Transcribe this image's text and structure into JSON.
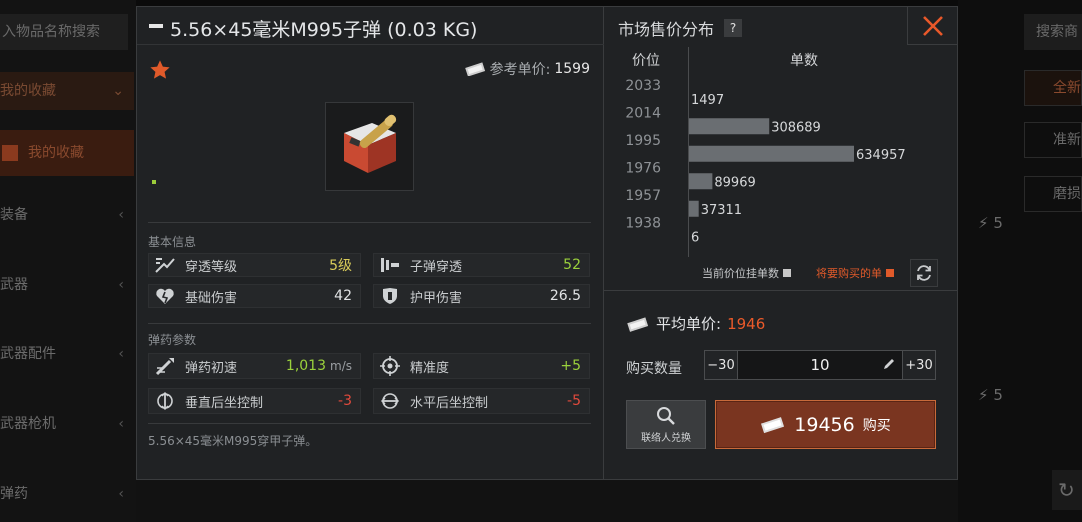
{
  "background": {
    "search_text": "入物品名称搜索",
    "fav_label": "我的收藏",
    "my_fav_label": "我的收藏",
    "categories": [
      "装备",
      "武器",
      "武器配件",
      "武器枪机",
      "弹药"
    ],
    "right_search": "搜索商",
    "right_buttons": [
      "全新",
      "准新",
      "磨损"
    ],
    "right_nums": [
      "5",
      "5"
    ]
  },
  "dialog": {
    "title": "5.56×45毫米M995子弹 (0.03 KG)",
    "ref_price_label": "参考单价:",
    "ref_price_value": "1599",
    "basic_info_label": "基本信息",
    "basic_stats": [
      {
        "icon": "penetration-level-icon",
        "label": "穿透等级",
        "value": "5级",
        "color": "#d9cc5a"
      },
      {
        "icon": "bullet-penetration-icon",
        "label": "子弹穿透",
        "value": "52",
        "color": "#9bd23c"
      },
      {
        "icon": "base-damage-icon",
        "label": "基础伤害",
        "value": "42",
        "color": "#e0e2e4"
      },
      {
        "icon": "armor-damage-icon",
        "label": "护甲伤害",
        "value": "26.5",
        "color": "#e0e2e4"
      }
    ],
    "ammo_params_label": "弹药参数",
    "ammo_stats": [
      {
        "icon": "muzzle-velocity-icon",
        "label": "弹药初速",
        "value": "1,013",
        "unit": "m/s",
        "color": "#9bd23c"
      },
      {
        "icon": "accuracy-icon",
        "label": "精准度",
        "value": "+5",
        "color": "#9bd23c"
      },
      {
        "icon": "vertical-recoil-icon",
        "label": "垂直后坐控制",
        "value": "-3",
        "color": "#e04a3c"
      },
      {
        "icon": "horizontal-recoil-icon",
        "label": "水平后坐控制",
        "value": "-5",
        "color": "#e04a3c"
      }
    ],
    "description": "5.56×45毫米M995穿甲子弹。"
  },
  "market": {
    "title": "市场售价分布",
    "help_badge": "?",
    "col_price": "价位",
    "col_count": "单数",
    "legend_current": "当前价位挂单数",
    "legend_current_color": "#c8c8c8",
    "legend_buy": "将要购买的单",
    "legend_buy_color": "#e05a2a",
    "avg_price_label": "平均单价:",
    "avg_price_value": "1946",
    "qty_label": "购买数量",
    "qty_minus": "−30",
    "qty_value": "10",
    "qty_plus": "+30",
    "contact_label": "联络人兑换",
    "buy_total": "19456",
    "buy_label": "购买"
  },
  "chart_data": {
    "type": "bar",
    "orientation": "horizontal",
    "xlabel": "单数",
    "ylabel": "价位",
    "y_tick_labels": [
      "2033",
      "2014",
      "1995",
      "1976",
      "1957",
      "1938"
    ],
    "categories": [
      "2033–2014",
      "2014–1995",
      "1995–1976",
      "1976–1957",
      "1957–1938",
      "1938–"
    ],
    "values": [
      1497,
      308689,
      634957,
      89969,
      37311,
      6
    ],
    "bar_color": "#6a6e72"
  }
}
